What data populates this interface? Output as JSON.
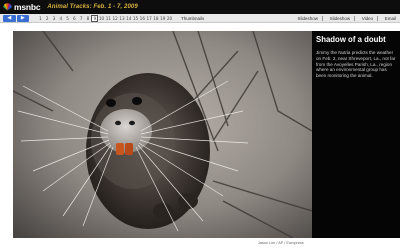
{
  "header": {
    "brand": "msnbc",
    "gallery_title": "Animal Tracks: Feb. 1 - 7, 2009"
  },
  "nav": {
    "prev_label": "◀",
    "next_label": "▶",
    "pages": [
      "1",
      "2",
      "3",
      "4",
      "5",
      "6",
      "7",
      "8",
      "9",
      "10",
      "11",
      "12",
      "13",
      "14",
      "15",
      "16",
      "17",
      "18",
      "19",
      "20"
    ],
    "active_page": "9",
    "thumbnails_label": "Thumbnails",
    "links": [
      "Slideshow",
      "Slideshow",
      "Video",
      "Email"
    ]
  },
  "photo": {
    "subject": "nutria close-up",
    "credit": "Jason Lim / AP / Europress"
  },
  "caption": {
    "title": "Shadow of a doubt",
    "body": "Jimmy the Nutria predicts the weather on Feb. 2, near Shreveport, La., not far from the Avoyelles Parish, La., region where an environmental group has been monitoring the animal."
  },
  "colors": {
    "header_bg": "#0d0d0d",
    "title_gold": "#d7b341",
    "nav_bg": "#e9e9e9",
    "arrow_blue": "#3a6fd1",
    "caption_bg": "#050505"
  }
}
